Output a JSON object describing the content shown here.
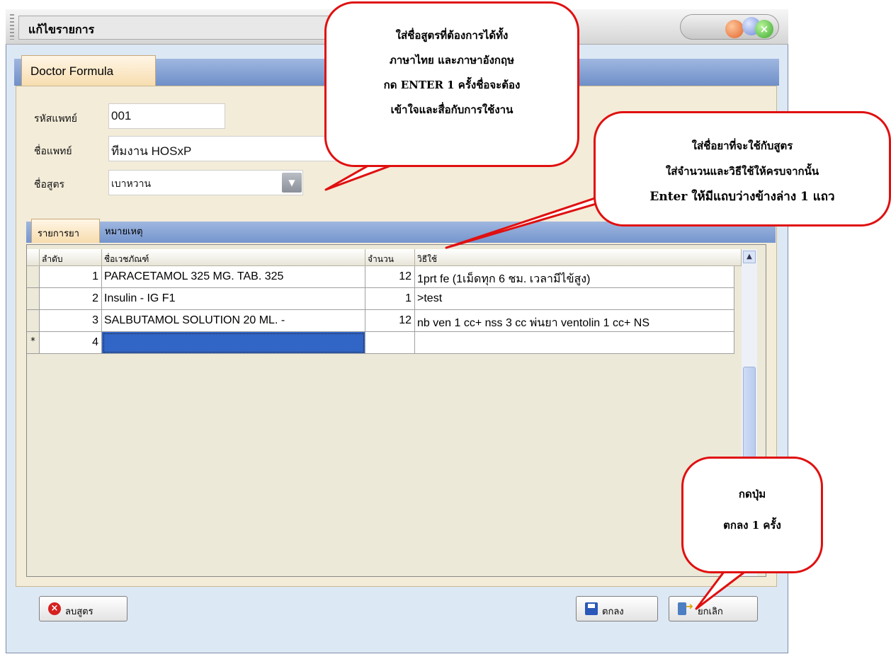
{
  "window": {
    "title": "แก้ไขรายการ"
  },
  "tab": {
    "label": "Doctor Formula"
  },
  "form": {
    "doctor_code_label": "รหัสแพทย์",
    "doctor_code_value": "001",
    "doctor_name_label": "ชื่อแพทย์",
    "doctor_name_value": "ทีมงาน HOSxP",
    "formula_name_label": "ชื่อสูตร",
    "formula_name_value": "เบาหวาน"
  },
  "inner_tabs": {
    "drugs": "รายการยา",
    "note": "หมายเหตุ"
  },
  "grid": {
    "headers": {
      "order": "ลำดับ",
      "drug": "ชื่อเวชภัณฑ์",
      "qty": "จำนวน",
      "usage": "วิธีใช้"
    },
    "rows": [
      {
        "order": "1",
        "drug": "PARACETAMOL 325 MG. TAB. 325",
        "qty": "12",
        "usage": "1prt fe (1เม็ดทุก 6 ชม. เวลามีไข้สูง)"
      },
      {
        "order": "2",
        "drug": "Insulin - IG F1",
        "qty": "1",
        "usage": ">test"
      },
      {
        "order": "3",
        "drug": "SALBUTAMOL SOLUTION 20 ML. -",
        "qty": "12",
        "usage": "nb ven 1 cc+ nss 3 cc พ่นยา ventolin 1 cc+ NS"
      },
      {
        "order": "4",
        "drug": "",
        "qty": "",
        "usage": "",
        "indicator": "*"
      }
    ]
  },
  "buttons": {
    "delete": "ลบสูตร",
    "ok": "ตกลง",
    "cancel": "ยกเลิก"
  },
  "callouts": {
    "formula": [
      "ใส่ชื่อสูตรที่ต้องการได้ทั้ง",
      "ภาษาไทย และภาษาอังกฤษ",
      "กด ENTER 1 ครั้งชื่อจะต้อง",
      "เข้าใจและสื่อกับการใช้งาน"
    ],
    "drug": [
      "ใส่ชื่อยาที่จะใช้กับสูตร",
      "ใส่จำนวนและวิธีใช้ให้ครบจากนั้น",
      "Enter ให้มีแถบว่างข้างล่าง 1 แถว"
    ],
    "ok": [
      "กดปุ่ม",
      "ตกลง 1 ครั้ง"
    ]
  },
  "icons": [
    "close-icon",
    "delete-icon",
    "save-icon",
    "exit-icon",
    "dropdown-arrow-icon",
    "scroll-up-icon"
  ],
  "colors": {
    "callout_border": "#e01010",
    "tab_bar": "#7595cc",
    "selected_cell": "#3165c6",
    "form_bg": "#f3ecd9"
  }
}
